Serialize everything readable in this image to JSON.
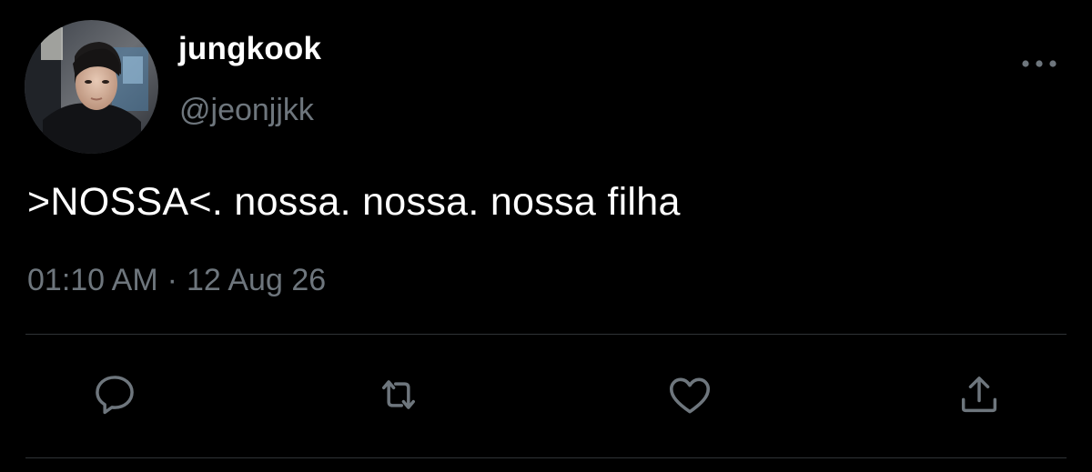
{
  "tweet": {
    "author": {
      "display_name": "jungkook",
      "handle": "@jeonjjkk",
      "avatar_icon": "profile-photo"
    },
    "text": ">NOSSA<. nossa. nossa. nossa filha",
    "time": "01:10 AM",
    "separator": "·",
    "date": "12 Aug 26",
    "more_icon": "more-horizontal-icon"
  },
  "actions": [
    {
      "name": "reply",
      "icon": "reply-icon"
    },
    {
      "name": "retweet",
      "icon": "retweet-icon"
    },
    {
      "name": "like",
      "icon": "heart-icon"
    },
    {
      "name": "share",
      "icon": "share-icon"
    }
  ],
  "colors": {
    "background": "#000000",
    "text": "#ffffff",
    "secondary_text": "#6e767d",
    "divider": "#2f3336",
    "icon": "#6e767d"
  }
}
